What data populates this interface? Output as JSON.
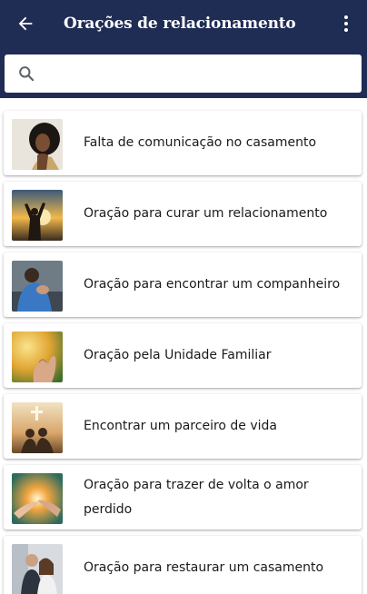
{
  "header": {
    "title": "Orações de relacionamento",
    "background": "#1f2d55"
  },
  "search": {
    "value": "",
    "placeholder": ""
  },
  "prayers": [
    {
      "label": "Falta de comunicação no casamento",
      "image": "woman-portrait"
    },
    {
      "label": "Oração para curar um relacionamento",
      "image": "sunset-raised-arms"
    },
    {
      "label": "Oração para encontrar um companheiro",
      "image": "kneeling-man-praying"
    },
    {
      "label": "Oração pela Unidade Familiar",
      "image": "open-hands-light"
    },
    {
      "label": "Encontrar um parceiro de vida",
      "image": "couple-sunset-cross"
    },
    {
      "label": "Oração para trazer de volta o amor perdido",
      "image": "glowing-hands"
    },
    {
      "label": "Oração para restaurar um casamento",
      "image": "couple-portrait"
    }
  ]
}
